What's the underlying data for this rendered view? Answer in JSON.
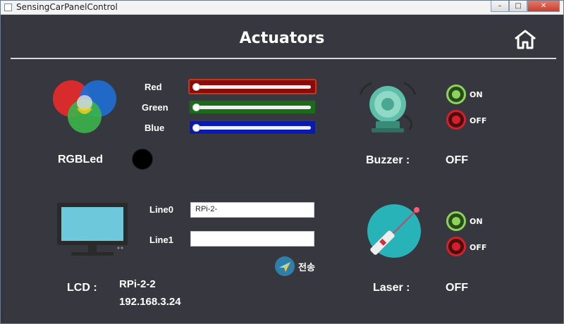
{
  "window": {
    "title": "SensingCarPanelControl"
  },
  "header": {
    "title": "Actuators"
  },
  "rgb": {
    "label": "RGBLed",
    "sliders": [
      {
        "label": "Red",
        "color": "#8b0a0a",
        "value": 0
      },
      {
        "label": "Green",
        "color": "#1a6b1a",
        "value": 0
      },
      {
        "label": "Blue",
        "color": "#0a1ab0",
        "value": 0
      }
    ],
    "led_color": "#000000"
  },
  "buzzer": {
    "label": "Buzzer :",
    "status": "OFF",
    "on_label": "ON",
    "off_label": "OFF"
  },
  "lcd": {
    "label": "LCD :",
    "line0_label": "Line0",
    "line1_label": "Line1",
    "line0_value": "RPi-2-",
    "line1_value": "",
    "send_label": "전송",
    "display_line0": "RPi-2-2",
    "display_line1": "192.168.3.24"
  },
  "laser": {
    "label": "Laser :",
    "status": "OFF",
    "on_label": "ON",
    "off_label": "OFF"
  },
  "colors": {
    "background": "#37373f",
    "accent_on": "#8bd35a",
    "accent_off": "#d61f2a"
  }
}
